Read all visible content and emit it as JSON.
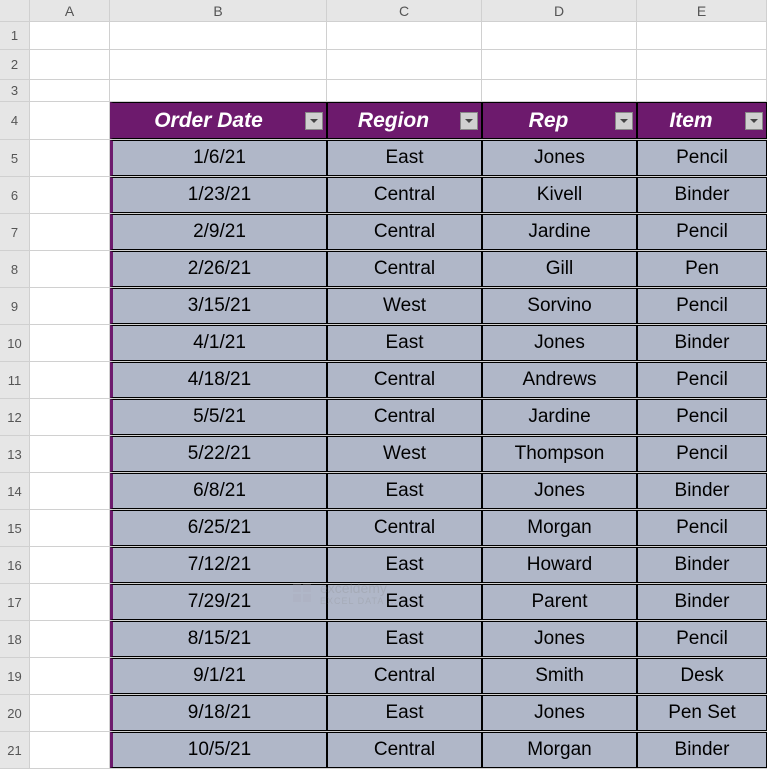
{
  "columns": [
    {
      "letter": "A",
      "cls": "col-a"
    },
    {
      "letter": "B",
      "cls": "col-b"
    },
    {
      "letter": "C",
      "cls": "col-c"
    },
    {
      "letter": "D",
      "cls": "col-d"
    },
    {
      "letter": "E",
      "cls": "col-e"
    }
  ],
  "empty_rows": [
    1,
    2,
    3
  ],
  "table_headers": [
    {
      "label": "Order Date",
      "name": "order-date"
    },
    {
      "label": "Region",
      "name": "region"
    },
    {
      "label": "Rep",
      "name": "rep"
    },
    {
      "label": "Item",
      "name": "item"
    }
  ],
  "table_data": [
    {
      "date": "1/6/21",
      "region": "East",
      "rep": "Jones",
      "item": "Pencil"
    },
    {
      "date": "1/23/21",
      "region": "Central",
      "rep": "Kivell",
      "item": "Binder"
    },
    {
      "date": "2/9/21",
      "region": "Central",
      "rep": "Jardine",
      "item": "Pencil"
    },
    {
      "date": "2/26/21",
      "region": "Central",
      "rep": "Gill",
      "item": "Pen"
    },
    {
      "date": "3/15/21",
      "region": "West",
      "rep": "Sorvino",
      "item": "Pencil"
    },
    {
      "date": "4/1/21",
      "region": "East",
      "rep": "Jones",
      "item": "Binder"
    },
    {
      "date": "4/18/21",
      "region": "Central",
      "rep": "Andrews",
      "item": "Pencil"
    },
    {
      "date": "5/5/21",
      "region": "Central",
      "rep": "Jardine",
      "item": "Pencil"
    },
    {
      "date": "5/22/21",
      "region": "West",
      "rep": "Thompson",
      "item": "Pencil"
    },
    {
      "date": "6/8/21",
      "region": "East",
      "rep": "Jones",
      "item": "Binder"
    },
    {
      "date": "6/25/21",
      "region": "Central",
      "rep": "Morgan",
      "item": "Pencil"
    },
    {
      "date": "7/12/21",
      "region": "East",
      "rep": "Howard",
      "item": "Binder"
    },
    {
      "date": "7/29/21",
      "region": "East",
      "rep": "Parent",
      "item": "Binder"
    },
    {
      "date": "8/15/21",
      "region": "East",
      "rep": "Jones",
      "item": "Pencil"
    },
    {
      "date": "9/1/21",
      "region": "Central",
      "rep": "Smith",
      "item": "Desk"
    },
    {
      "date": "9/18/21",
      "region": "East",
      "rep": "Jones",
      "item": "Pen Set"
    },
    {
      "date": "10/5/21",
      "region": "Central",
      "rep": "Morgan",
      "item": "Binder"
    }
  ],
  "watermark": {
    "brand": "exceldemy",
    "sub": "EXCEL DATA ..."
  }
}
